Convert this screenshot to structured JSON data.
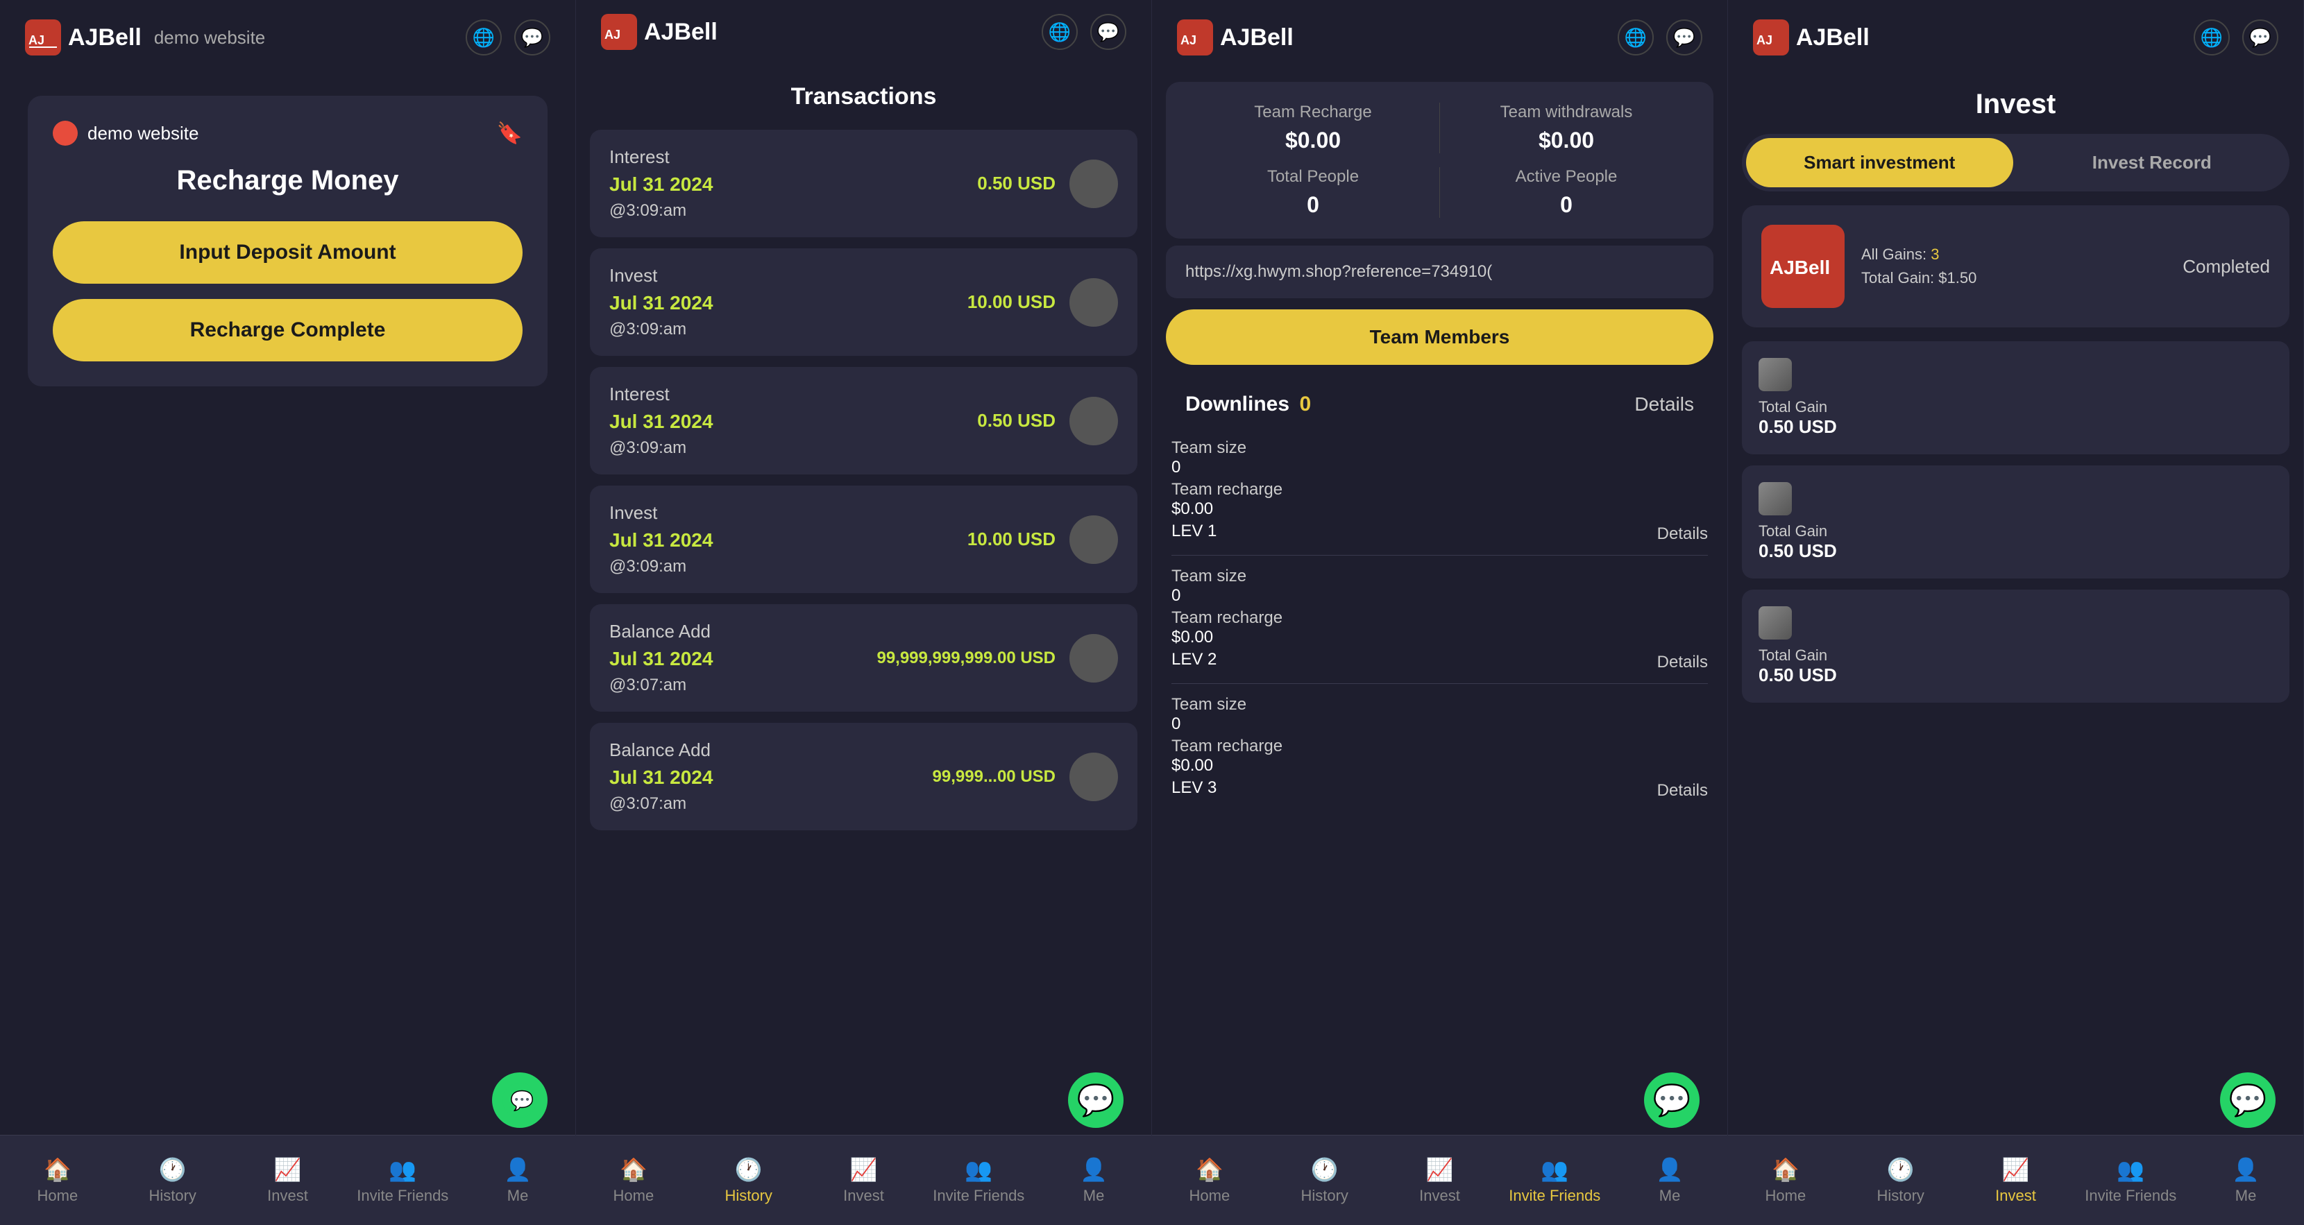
{
  "panels": [
    {
      "id": "recharge",
      "header": {
        "logo": "AJBell",
        "subtitle": "demo website",
        "icons": [
          "globe",
          "message"
        ]
      },
      "site_label": "demo website",
      "title": "Recharge Money",
      "input_placeholder": "Input Deposit Amount",
      "complete_btn": "Recharge Complete",
      "nav": [
        {
          "label": "Home",
          "icon": "🏠",
          "active": false
        },
        {
          "label": "History",
          "icon": "🕐",
          "active": false
        },
        {
          "label": "Invest",
          "icon": "👤",
          "active": false
        },
        {
          "label": "Invite Friends",
          "icon": "👥",
          "active": false
        },
        {
          "label": "Me",
          "icon": "👤",
          "active": false
        }
      ]
    },
    {
      "id": "transactions",
      "header": {
        "logo": "AJBell",
        "icons": [
          "globe",
          "message"
        ]
      },
      "title": "Transactions",
      "items": [
        {
          "type": "Interest",
          "date": "Jul 31 2024",
          "time": "@3:09:am",
          "amount": "0.50 USD"
        },
        {
          "type": "Invest",
          "date": "Jul 31 2024",
          "time": "@3:09:am",
          "amount": "10.00 USD"
        },
        {
          "type": "Interest",
          "date": "Jul 31 2024",
          "time": "@3:09:am",
          "amount": "0.50 USD"
        },
        {
          "type": "Invest",
          "date": "Jul 31 2024",
          "time": "@3:09:am",
          "amount": "10.00 USD"
        },
        {
          "type": "Balance Add",
          "date": "Jul 31 2024",
          "time": "@3:07:am",
          "amount": "99,999,999,999.00 USD"
        },
        {
          "type": "Balance Add",
          "date": "Jul 31 2024",
          "time": "@3:07:am",
          "amount": "99,999...00 USD"
        }
      ],
      "nav": [
        {
          "label": "Home",
          "active": false
        },
        {
          "label": "History",
          "active": true
        },
        {
          "label": "Invest",
          "active": false
        },
        {
          "label": "Invite Friends",
          "active": false
        },
        {
          "label": "Me",
          "active": false
        }
      ]
    },
    {
      "id": "team",
      "header": {
        "logo": "AJBell",
        "icons": [
          "globe",
          "message"
        ]
      },
      "stats": {
        "team_recharge_label": "Team Recharge",
        "team_recharge_value": "$0.00",
        "team_withdrawals_label": "Team withdrawals",
        "team_withdrawals_value": "$0.00",
        "total_people_label": "Total People",
        "total_people_value": "0",
        "active_people_label": "Active People",
        "active_people_value": "0"
      },
      "reflink": "https://xg.hwym.shop?reference=734910(",
      "team_members_btn": "Team Members",
      "downlines": {
        "title": "Downlines",
        "count": "0",
        "details_label": "Details",
        "levels": [
          {
            "team_size_label": "Team size",
            "team_size_val": "0",
            "team_recharge_label": "Team recharge",
            "team_recharge_val": "$0.00",
            "level_label": "LEV 1",
            "details_label": "Details"
          },
          {
            "team_size_label": "Team size",
            "team_size_val": "0",
            "team_recharge_label": "Team recharge",
            "team_recharge_val": "$0.00",
            "level_label": "LEV 2",
            "details_label": "Details"
          },
          {
            "team_size_label": "Team size",
            "team_size_val": "0",
            "team_recharge_label": "Team recharge",
            "team_recharge_val": "$0.00",
            "level_label": "LEV 3",
            "details_label": "Details"
          }
        ]
      },
      "nav": [
        {
          "label": "Home",
          "active": false
        },
        {
          "label": "History",
          "active": false
        },
        {
          "label": "Invest",
          "active": false
        },
        {
          "label": "Invite Friends",
          "active": true
        },
        {
          "label": "Me",
          "active": false
        }
      ]
    },
    {
      "id": "invest",
      "header": {
        "logo": "AJBell",
        "icons": [
          "globe",
          "message"
        ]
      },
      "page_title": "Invest",
      "tabs": [
        {
          "label": "Smart investment",
          "active": true
        },
        {
          "label": "Invest Record",
          "active": false
        }
      ],
      "featured": {
        "logo": "AJBell",
        "all_gains_label": "All Gains:",
        "all_gains_val": "3",
        "total_gain_label": "Total Gain:",
        "total_gain_val": "$1.50",
        "status": "Completed"
      },
      "records": [
        {
          "gain_label": "Total Gain",
          "gain_val": "0.50 USD"
        },
        {
          "gain_label": "Total Gain",
          "gain_val": "0.50 USD"
        },
        {
          "gain_label": "Total Gain",
          "gain_val": "0.50 USD"
        }
      ],
      "nav": [
        {
          "label": "Home",
          "active": false
        },
        {
          "label": "History",
          "active": false
        },
        {
          "label": "Invest",
          "active": true
        },
        {
          "label": "Invite Friends",
          "active": false
        },
        {
          "label": "Me",
          "active": false
        }
      ]
    }
  ],
  "nav_icons": {
    "home": "🏠",
    "history": "🕐",
    "invest": "📈",
    "invite": "👥",
    "me": "👤"
  },
  "whatsapp_icon": "💬",
  "colors": {
    "accent": "#e8c840",
    "bg_dark": "#1e1e2e",
    "bg_card": "#2a2a3e",
    "green": "#c8e840",
    "text_muted": "#aaa",
    "white": "#fff"
  }
}
